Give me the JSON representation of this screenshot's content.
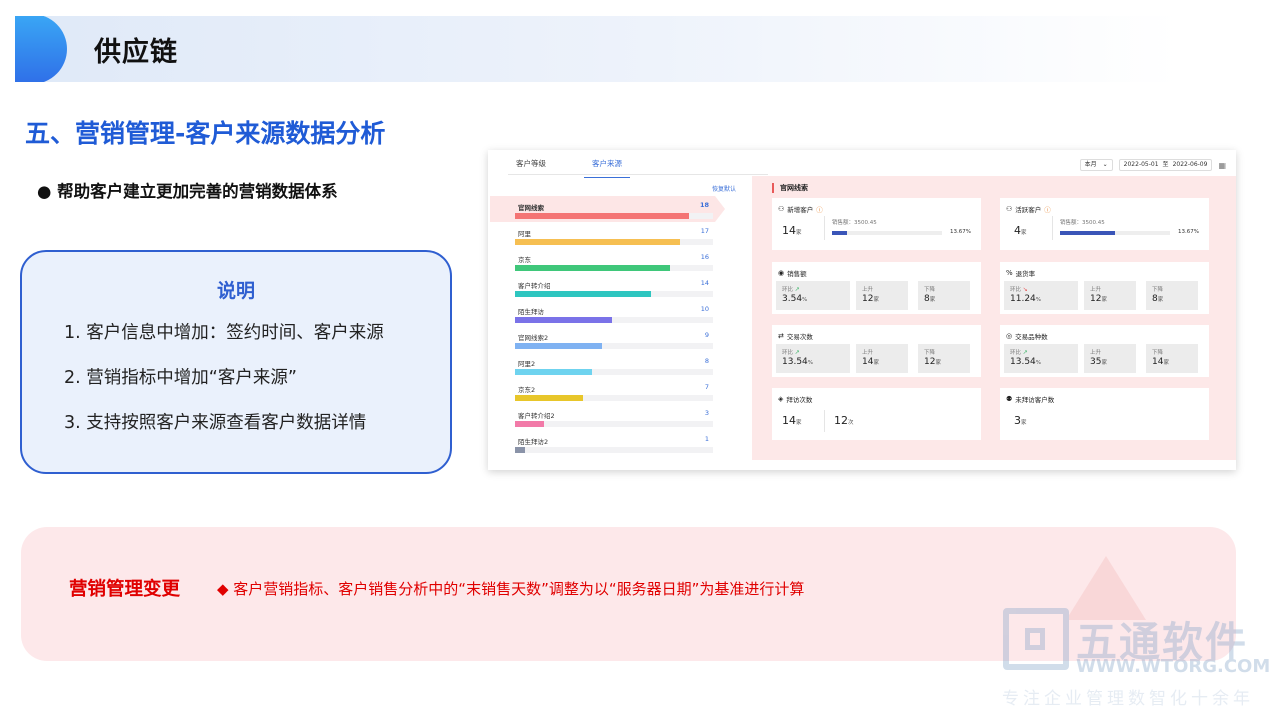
{
  "header": {
    "title": "供应链"
  },
  "section": {
    "title": "五、营销管理-客户来源数据分析"
  },
  "bullet": {
    "text": "帮助客户建立更加完善的营销数据体系"
  },
  "note": {
    "title": "说明",
    "items": [
      "1. 客户信息中增加：签约时间、客户来源",
      "2. 营销指标中增加“客户来源”",
      "3. 支持按照客户来源查看客户数据详情"
    ]
  },
  "app": {
    "tabs": [
      "客户等级",
      "客户来源"
    ],
    "active_tab": "客户来源",
    "period_select": "本月",
    "date_from": "2022-05-01",
    "date_sep": "至",
    "date_to": "2022-06-09",
    "restore_default": "恢复默认",
    "sources": [
      {
        "name": "官网线索",
        "count": "18",
        "value": 18,
        "color": "#f47474"
      },
      {
        "name": "阿里",
        "count": "17",
        "value": 17,
        "color": "#f6bf52"
      },
      {
        "name": "京东",
        "count": "16",
        "value": 16,
        "color": "#3fc77a"
      },
      {
        "name": "客户转介绍",
        "count": "14",
        "value": 14,
        "color": "#2ec6c0"
      },
      {
        "name": "陌生拜访",
        "count": "10",
        "value": 10,
        "color": "#7a72e8"
      },
      {
        "name": "官网线索2",
        "count": "9",
        "value": 9,
        "color": "#7fb2f2"
      },
      {
        "name": "阿里2",
        "count": "8",
        "value": 8,
        "color": "#6fd3ef"
      },
      {
        "name": "京东2",
        "count": "7",
        "value": 7,
        "color": "#e8c62a"
      },
      {
        "name": "客户转介绍2",
        "count": "3",
        "value": 3,
        "color": "#f27aa8"
      },
      {
        "name": "陌生拜访2",
        "count": "1",
        "value": 1,
        "color": "#8a93a8"
      }
    ],
    "detail": {
      "heading": "官网线索",
      "new_customers": {
        "title": "新增客户",
        "value": "14",
        "unit": "家",
        "sales_label": "销售额：",
        "sales_value": "3500.45",
        "percent": "13.67%",
        "ratio": 0.1367
      },
      "active_customers": {
        "title": "活跃客户",
        "value": "4",
        "unit": "家",
        "sales_label": "销售额：",
        "sales_value": "3500.45",
        "percent": "13.67%",
        "ratio": 0.5
      },
      "sales": {
        "title": "销售额",
        "mom_label": "环比",
        "mom_value": "3.54",
        "mom_unit": "%",
        "up_label": "上升",
        "up_value": "12",
        "up_unit": "家",
        "down_label": "下降",
        "down_value": "8",
        "down_unit": "家"
      },
      "return_rate": {
        "title": "退货率",
        "mom_label": "环比",
        "mom_value": "11.24",
        "mom_unit": "%",
        "up_label": "上升",
        "up_value": "12",
        "up_unit": "家",
        "down_label": "下降",
        "down_value": "8",
        "down_unit": "家"
      },
      "trade_count": {
        "title": "交易次数",
        "mom_label": "环比",
        "mom_value": "13.54",
        "mom_unit": "%",
        "up_label": "上升",
        "up_value": "14",
        "up_unit": "家",
        "down_label": "下降",
        "down_value": "12",
        "down_unit": "家"
      },
      "trade_varieties": {
        "title": "交易品种数",
        "mom_label": "环比",
        "mom_value": "13.54",
        "mom_unit": "%",
        "up_label": "上升",
        "up_value": "35",
        "up_unit": "家",
        "down_label": "下降",
        "down_value": "14",
        "down_unit": "家"
      },
      "visits": {
        "title": "拜访次数",
        "customers_value": "14",
        "customers_unit": "家",
        "times_value": "12",
        "times_unit": "次"
      },
      "unvisited": {
        "title": "未拜访客户数",
        "value": "3",
        "unit": "家"
      }
    }
  },
  "change": {
    "label": "营销管理变更",
    "text": "◆ 客户营销指标、客户销售分析中的“末销售天数”调整为以“服务器日期”为基准进行计算"
  },
  "watermark": {
    "name": "五通软件",
    "url": "WWW.WTORG.COM",
    "slogan": "专注企业管理数智化十余年"
  }
}
